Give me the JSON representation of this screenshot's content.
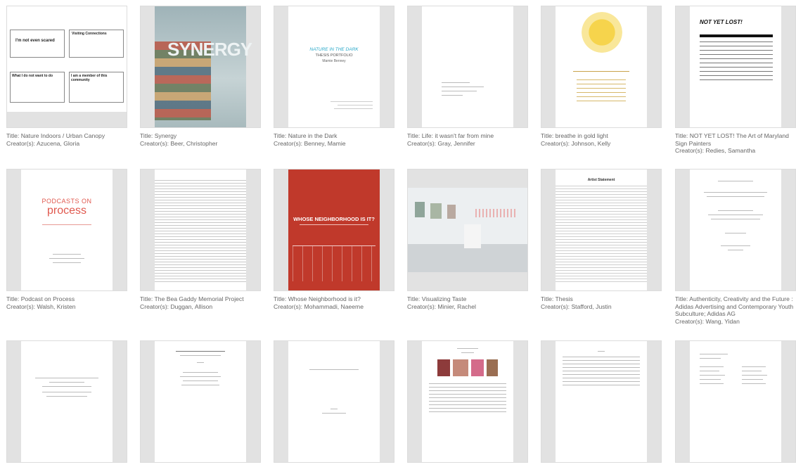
{
  "items": [
    {
      "title": "Title: Nature Indoors / Urban Canopy",
      "creator": "Creator(s): Azucena, Gloria",
      "thumb": {
        "box1": "I'm not even scared",
        "box2": "Visiting Connections",
        "box3": "What I do not want to do",
        "box4": "I am a member of this community"
      }
    },
    {
      "title": "Title: Synergy",
      "creator": "Creator(s): Beer, Christopher",
      "thumb": {
        "word": "SYNERGY"
      }
    },
    {
      "title": "Title: Nature in the Dark",
      "creator": "Creator(s): Benney, Mamie",
      "thumb": {
        "heading": "NATURE IN THE DARK",
        "sub1": "THESIS PORTFOLIO",
        "sub2": "Mamie Benney"
      }
    },
    {
      "title": "Title: Life: it wasn't far from mine",
      "creator": "Creator(s): Gray, Jennifer",
      "thumb": {}
    },
    {
      "title": "Title: breathe in gold light",
      "creator": "Creator(s): Johnson, Kelly",
      "thumb": {}
    },
    {
      "title": "Title: NOT YET LOST! The Art of Maryland Sign Painters",
      "creator": "Creator(s): Redies, Samantha",
      "thumb": {
        "heading": "NOT YET LOST!"
      }
    },
    {
      "title": "Title: Podcast on Process",
      "creator": "Creator(s): Walsh, Kristen",
      "thumb": {
        "line1": "PODCASTS ON",
        "line2": "process"
      }
    },
    {
      "title": "Title: The Bea Gaddy Memorial Project",
      "creator": "Creator(s): Duggan, Allison",
      "thumb": {}
    },
    {
      "title": "Title: Whose Neighborhood is it?",
      "creator": "Creator(s): Mohammadi, Naeeme",
      "thumb": {
        "heading": "WHOSE NEIGHBORHOOD IS IT?"
      }
    },
    {
      "title": "Title: Visualizing Taste",
      "creator": "Creator(s): Minier, Rachel",
      "thumb": {}
    },
    {
      "title": "Title: Thesis",
      "creator": "Creator(s): Stafford, Justin",
      "thumb": {
        "heading": "Artist Statement"
      }
    },
    {
      "title": "Title: Authenticity, Creativity and the Future : Adidas Advertising and Contemporary Youth Subculture; Adidas AG",
      "creator": "Creator(s): Wang, Yidan",
      "thumb": {}
    },
    {
      "title": "",
      "creator": "",
      "thumb": {}
    },
    {
      "title": "",
      "creator": "",
      "thumb": {}
    },
    {
      "title": "",
      "creator": "",
      "thumb": {}
    },
    {
      "title": "",
      "creator": "",
      "thumb": {}
    },
    {
      "title": "",
      "creator": "",
      "thumb": {}
    },
    {
      "title": "",
      "creator": "",
      "thumb": {}
    }
  ]
}
